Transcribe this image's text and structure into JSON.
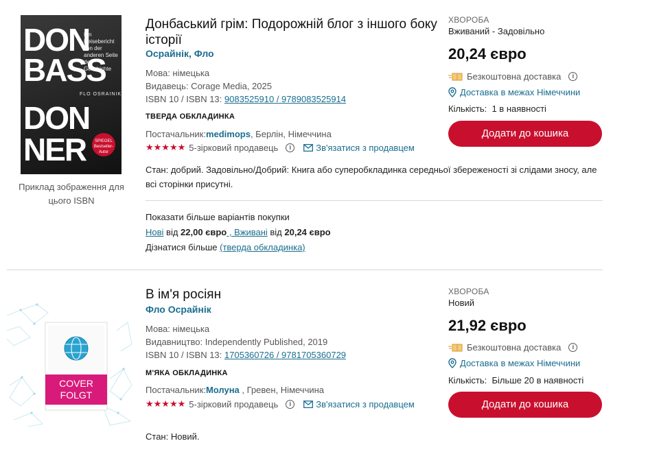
{
  "listings": [
    {
      "cover": {
        "lines": [
          "DON",
          "BASS",
          "DON",
          "NER"
        ],
        "side_text": "Ein Reisebericht von der anderen Seite der Geschichte",
        "author_small": "FLO OSRAINIK",
        "sticker": "SPIEGEL Bestseller-Autor"
      },
      "caption": "Приклад зображення для цього ISBN",
      "title": "Донбаський грім: Подорожній блог з іншого боку історії",
      "author": "Осрайнік, Фло",
      "language": "Мова: німецька",
      "publisher": "Видавець: Corage Media, 2025",
      "isbn_label": "ISBN 10 / ISBN 13:",
      "isbn_value": "9083525910  /  9789083525914",
      "binding": "ТВЕРДА ОБКЛАДИНКА",
      "supplier_label": "Постачальник:",
      "supplier_name": "medimops",
      "supplier_location": ", Берлін, Німеччина",
      "stars": "★★★★★",
      "rating": "5-зірковий продавець",
      "contact": "Зв'язатися з продавцем",
      "condition": "Стан: добрий. Задовільно/Добрий: Книга або суперобкладинка середньої збереженості зі слідами зносу, але всі сторінки присутні.",
      "category": "ХВОРОБА",
      "state": "Вживаний - Задовільно",
      "price": "20,24 євро",
      "shipping": "Безкоштовна доставка",
      "delivery": "Доставка в межах Німеччини",
      "qty_label": "Кількість:",
      "qty_value": "1 в наявності",
      "button": "Додати до кошика",
      "more": {
        "heading": "Показати більше варіантів покупки",
        "new_link": "Нові",
        "new_from": " від ",
        "new_price": "22,00 євро",
        "sep": " , ",
        "used_link": "Вживані",
        "used_from": " від ",
        "used_price": "20,24 євро",
        "learn": "Дізнатися більше ",
        "learn_link": "(тверда обкладинка)"
      }
    },
    {
      "cover": {
        "lines": [
          "COVER",
          "FOLGT"
        ]
      },
      "title": "В ім'я росіян",
      "author": "Фло Осрайнік",
      "language": "Мова: німецька",
      "publisher": "Видавництво: Independently Published, 2019",
      "isbn_label": "ISBN 10 / ISBN 13:",
      "isbn_value": "1705360726  /  9781705360729",
      "binding": "М'ЯКА ОБКЛАДИНКА",
      "supplier_label": "Постачальник:",
      "supplier_name": "Молуна",
      "supplier_location": " , Гревен, Німеччина",
      "stars": "★★★★★",
      "rating": "5-зірковий продавець",
      "contact": "Зв'язатися з продавцем",
      "condition": "Стан: Новий.",
      "category": "ХВОРОБА",
      "state": "Новий",
      "price": "21,92 євро",
      "shipping": "Безкоштовна доставка",
      "delivery": "Доставка в межах Німеччини",
      "qty_label": "Кількість:",
      "qty_value": "Більше 20 в наявності",
      "button": "Додати до кошика"
    }
  ],
  "colors": {
    "accent": "#c8102e",
    "link": "#1a6d8f",
    "cover_pink": "#d81b7a"
  },
  "icons": [
    "package-icon",
    "info-icon",
    "location-pin-icon",
    "mail-icon",
    "star-icon",
    "globe-icon"
  ]
}
